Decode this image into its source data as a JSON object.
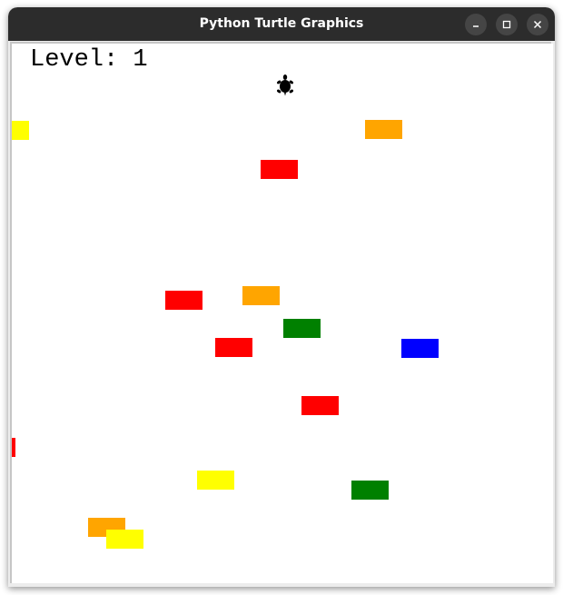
{
  "window": {
    "title": "Python Turtle Graphics"
  },
  "titlebar_buttons": {
    "minimize": "minimize-icon",
    "maximize": "maximize-icon",
    "close": "close-icon"
  },
  "game": {
    "level_text": "Level: 1",
    "player_icon": "turtle-icon",
    "colors": {
      "red": "#ff0000",
      "orange": "#ffa500",
      "yellow": "#ffff00",
      "green": "#008000",
      "blue": "#0000ff",
      "turtle": "#000000"
    },
    "blocks": [
      {
        "color": "yellow"
      },
      {
        "color": "orange"
      },
      {
        "color": "red"
      },
      {
        "color": "red"
      },
      {
        "color": "orange"
      },
      {
        "color": "green"
      },
      {
        "color": "red"
      },
      {
        "color": "blue"
      },
      {
        "color": "red"
      },
      {
        "color": "red"
      },
      {
        "color": "yellow"
      },
      {
        "color": "green"
      },
      {
        "color": "orange"
      },
      {
        "color": "yellow"
      }
    ]
  }
}
